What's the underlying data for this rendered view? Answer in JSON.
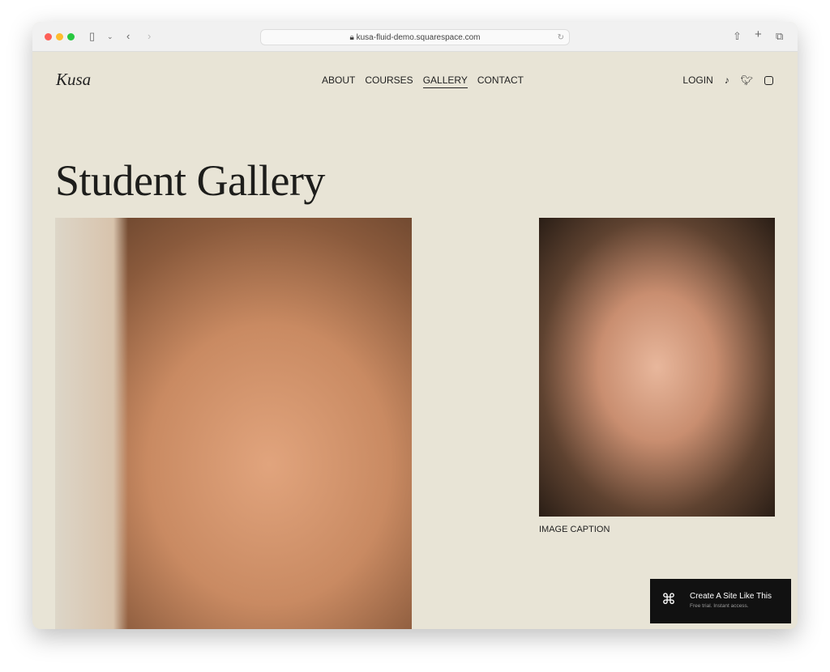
{
  "browser": {
    "url": "kusa-fluid-demo.squarespace.com"
  },
  "header": {
    "logo": "Kusa",
    "nav": [
      {
        "label": "ABOUT"
      },
      {
        "label": "COURSES"
      },
      {
        "label": "GALLERY",
        "active": true
      },
      {
        "label": "CONTACT"
      }
    ],
    "login": "LOGIN",
    "social": [
      "tiktok-icon",
      "twitter-icon",
      "instagram-icon"
    ]
  },
  "main": {
    "title": "Student Gallery",
    "caption": "IMAGE CAPTION"
  },
  "cta": {
    "title": "Create A Site Like This",
    "subtitle": "Free trial. Instant access."
  }
}
